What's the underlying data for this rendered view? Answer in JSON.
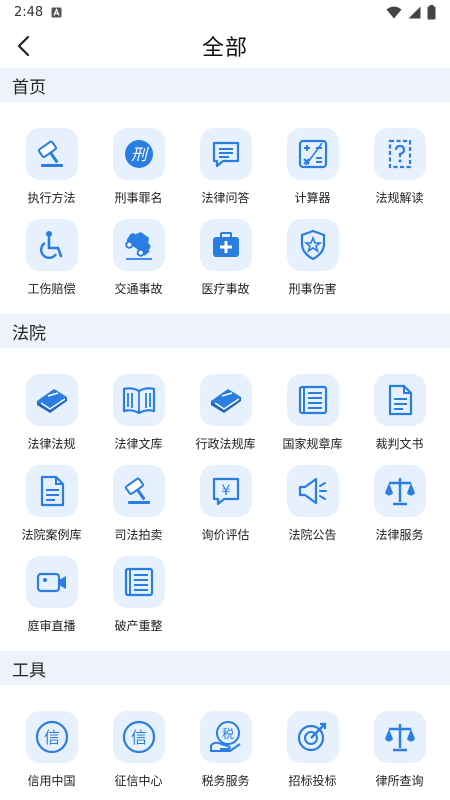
{
  "status": {
    "time": "2:48",
    "icons": [
      "notification-a-icon",
      "wifi-icon",
      "signal-icon",
      "battery-icon"
    ]
  },
  "nav": {
    "title": "全部",
    "back_icon": "chevron-left-icon"
  },
  "colors": {
    "accent": "#2a7de1",
    "tile_bg": "#e6f1fd",
    "section_bg": "#eef2fa"
  },
  "sections": [
    {
      "title": "首页",
      "items": [
        {
          "label": "执行方法",
          "icon": "gavel-icon"
        },
        {
          "label": "刑事罪名",
          "icon": "criminal-law-icon"
        },
        {
          "label": "法律问答",
          "icon": "chat-bubble-icon"
        },
        {
          "label": "计算器",
          "icon": "calculator-icon"
        },
        {
          "label": "法规解读",
          "icon": "question-document-icon"
        },
        {
          "label": "工伤赔偿",
          "icon": "wheelchair-icon"
        },
        {
          "label": "交通事故",
          "icon": "car-crash-icon"
        },
        {
          "label": "医疗事故",
          "icon": "medical-kit-icon"
        },
        {
          "label": "刑事伤害",
          "icon": "police-badge-icon"
        }
      ]
    },
    {
      "title": "法院",
      "items": [
        {
          "label": "法律法规",
          "icon": "law-book-icon"
        },
        {
          "label": "法律文库",
          "icon": "open-book-icon"
        },
        {
          "label": "行政法规库",
          "icon": "law-book-icon"
        },
        {
          "label": "国家规章库",
          "icon": "newspaper-icon"
        },
        {
          "label": "裁判文书",
          "icon": "document-icon"
        },
        {
          "label": "法院案例库",
          "icon": "document-icon"
        },
        {
          "label": "司法拍卖",
          "icon": "gavel-icon"
        },
        {
          "label": "询价评估",
          "icon": "yuan-chat-icon"
        },
        {
          "label": "法院公告",
          "icon": "megaphone-icon"
        },
        {
          "label": "法律服务",
          "icon": "scales-icon"
        },
        {
          "label": "庭审直播",
          "icon": "video-camera-icon"
        },
        {
          "label": "破产重整",
          "icon": "newspaper-icon"
        }
      ]
    },
    {
      "title": "工具",
      "items": [
        {
          "label": "信用中国",
          "icon": "credit-circle-icon"
        },
        {
          "label": "征信中心",
          "icon": "credit-circle-icon"
        },
        {
          "label": "税务服务",
          "icon": "tax-hand-icon"
        },
        {
          "label": "招标投标",
          "icon": "target-arrow-icon"
        },
        {
          "label": "律所查询",
          "icon": "scales-icon"
        }
      ]
    }
  ],
  "glyphs": {
    "criminal": "刑",
    "credit": "信",
    "tax": "税",
    "yuan": "¥"
  }
}
